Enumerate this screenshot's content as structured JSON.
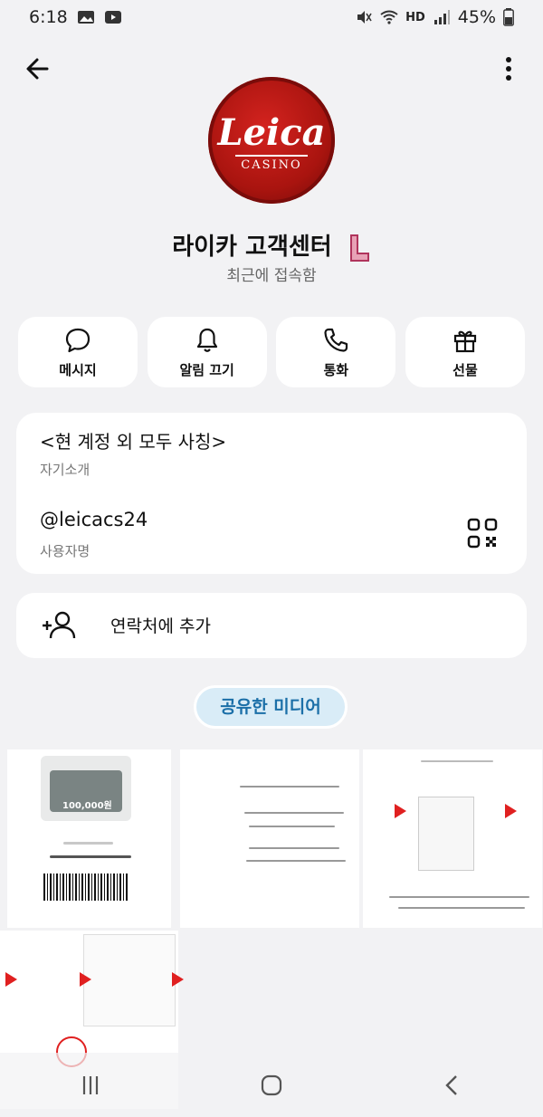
{
  "status_bar": {
    "time": "6:18",
    "hd_label": "HD",
    "battery": "45%"
  },
  "profile": {
    "avatar_brand": "Leica",
    "avatar_sub": "CASINO",
    "name": "라이카 고객센터",
    "status": "최근에 접속함"
  },
  "actions": [
    {
      "label": "메시지",
      "icon": "chat-bubble-icon"
    },
    {
      "label": "알림 끄기",
      "icon": "bell-icon"
    },
    {
      "label": "통화",
      "icon": "phone-icon"
    },
    {
      "label": "선물",
      "icon": "gift-icon"
    }
  ],
  "info": {
    "bio": "<현 계정 외 모두 사칭>",
    "bio_label": "자기소개",
    "username": "@leicacs24",
    "username_label": "사용자명"
  },
  "add_contact": {
    "label": "연락처에 추가"
  },
  "media": {
    "tab_label": "공유한 미디어",
    "thumbnails": [
      {
        "amount": "100,000원"
      },
      {
        "amount": ""
      },
      {
        "amount": ""
      },
      {
        "amount": ""
      }
    ]
  },
  "colors": {
    "background": "#f2f2f4",
    "card": "#ffffff",
    "accent_chip_bg": "#d9ecf7",
    "accent_chip_text": "#1b6fa8",
    "avatar_red": "#b5160f"
  }
}
